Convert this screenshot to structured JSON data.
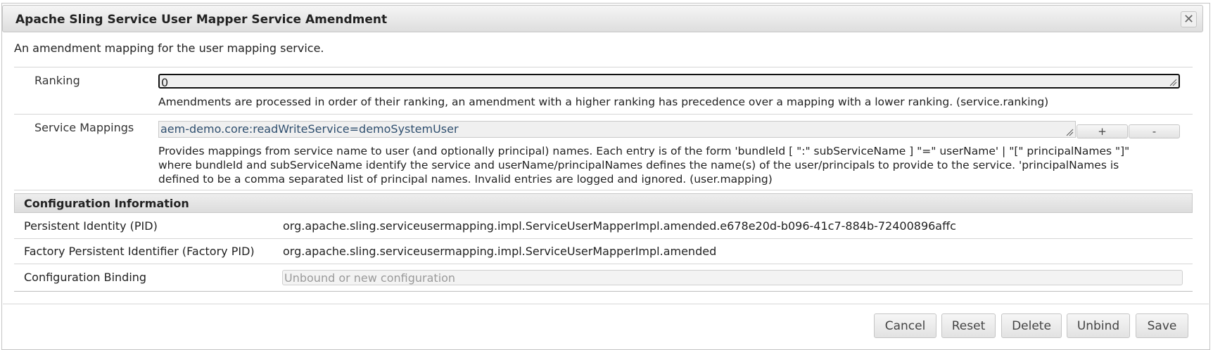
{
  "dialog": {
    "title": "Apache Sling Service User Mapper Service Amendment",
    "close_icon": "close-icon",
    "close_glyph": "✕",
    "description": "An amendment mapping for the user mapping service."
  },
  "fields": {
    "ranking": {
      "label": "Ranking",
      "value": "0",
      "help": "Amendments are processed in order of their ranking, an amendment with a higher ranking has precedence over a mapping with a lower ranking. (service.ranking)"
    },
    "service_mappings": {
      "label": "Service Mappings",
      "value": "aem-demo.core:readWriteService=demoSystemUser",
      "add_label": "+",
      "remove_label": "-",
      "help_lines": [
        "Provides mappings from service name to user (and optionally principal) names. Each entry is of the form 'bundleId [ \":\" subServiceName ] \"=\" userName' | \"[\" principalNames \"]\"",
        "where bundleId and subServiceName identify the service and userName/principalNames defines the name(s) of the user/principals to provide to the service. 'principalNames is",
        "defined to be a comma separated list of principal names. Invalid entries are logged and ignored. (user.mapping)"
      ]
    }
  },
  "config_info": {
    "heading": "Configuration Information",
    "rows": [
      {
        "label": "Persistent Identity (PID)",
        "value": "org.apache.sling.serviceusermapping.impl.ServiceUserMapperImpl.amended.e678e20d-b096-41c7-884b-72400896affc"
      },
      {
        "label": "Factory Persistent Identifier (Factory PID)",
        "value": "org.apache.sling.serviceusermapping.impl.ServiceUserMapperImpl.amended"
      },
      {
        "label": "Configuration Binding",
        "placeholder": "Unbound or new configuration"
      }
    ]
  },
  "buttons": {
    "cancel": "Cancel",
    "reset": "Reset",
    "delete": "Delete",
    "unbind": "Unbind",
    "save": "Save"
  },
  "colors": {
    "title_bar": "#dedede",
    "mapping_text": "#2f4f6f"
  }
}
